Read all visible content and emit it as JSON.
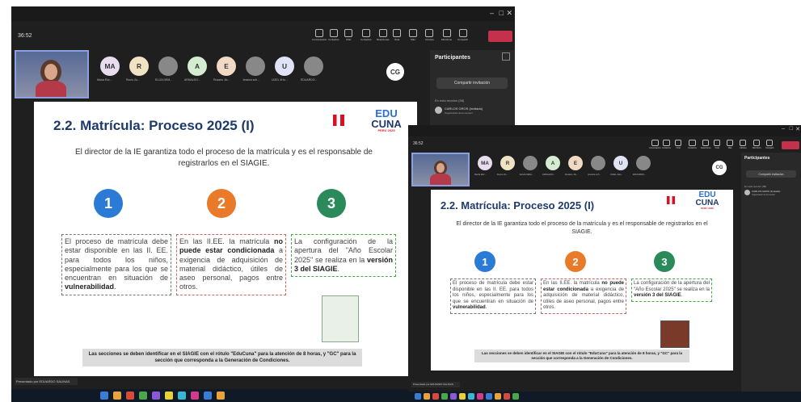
{
  "meeting": {
    "time": "36:52",
    "toolbar": [
      "Conversación",
      "Contactos",
      "Chat",
      "Contactos",
      "Reacciones",
      "Vista",
      "Más",
      "Cámara",
      "Micrófono",
      "Compartir"
    ]
  },
  "participants": [
    {
      "initials": "MA",
      "name": "María Elíz...",
      "color": "#e8dcef"
    },
    {
      "initials": "R",
      "name": "Rocío Zu...",
      "color": "#f2e2c4"
    },
    {
      "initials": "",
      "name": "ELIZA DEM...",
      "color": "#888888"
    },
    {
      "initials": "A",
      "name": "ARNALDO...",
      "color": "#d4ecd0"
    },
    {
      "initials": "E",
      "name": "Rosario Jlo...",
      "color": "#f1d9c4"
    },
    {
      "initials": "",
      "name": "Jessica sch...",
      "color": "#888888"
    },
    {
      "initials": "U",
      "name": "UGEL 4Ho...",
      "color": "#dfe3f5"
    },
    {
      "initials": "",
      "name": "EDUARDO...",
      "color": "#888888"
    }
  ],
  "extra_participant": {
    "initials": "CG"
  },
  "panel": {
    "title": "Participantes",
    "share_label": "Compartir invitación",
    "section": "En esta reunión (58)",
    "person_name": "CARLOS GROS (Invitado)",
    "person_role": "Organizador de la reunión"
  },
  "slide": {
    "title": "2.2. Matrícula: Proceso 2025 (I)",
    "intro": "El director de la IE garantiza todo el proceso de la matrícula y es el responsable de registrarlos en el SIAGIE.",
    "logo_top": "EDU",
    "logo_bottom": "CUNA",
    "logo_sub": "PERÚ 2025",
    "steps": [
      {
        "number": "1",
        "color": "#2b7bd6",
        "text_before": "El proceso de matrícula debe estar disponible en las II. EE. para todos los niños, especialmente para los que se encuentran en situación de ",
        "bold": "vulnerabilidad",
        "text_after": "."
      },
      {
        "number": "2",
        "color": "#e87a2a",
        "text_before": "En las II.EE. la matrícula ",
        "bold": "no puede estar condicionada",
        "text_after": " a exigencia de adquisición de material didáctico, útiles de aseo personal, pagos entre otros."
      },
      {
        "number": "3",
        "color": "#2a8a5a",
        "text_before": "La configuración de la apertura del \"Año Escolar 2025\" se realiza en la ",
        "bold": "versión 3 del SIAGIE",
        "text_after": "."
      }
    ],
    "footer": "Las secciones se deben identificar en el SIAGIE con el rótulo \"EduCuna\" para la atención de 8 horas, y \"GC\" para la sección que corresponda a la Generación de Condiciones."
  },
  "presenter_caption": "Presentado por EDUARDO SALINAS",
  "colors": {
    "accent": "#1d3a6b",
    "teams_bg": "#1f1f1f",
    "leave": "#c4314b"
  }
}
